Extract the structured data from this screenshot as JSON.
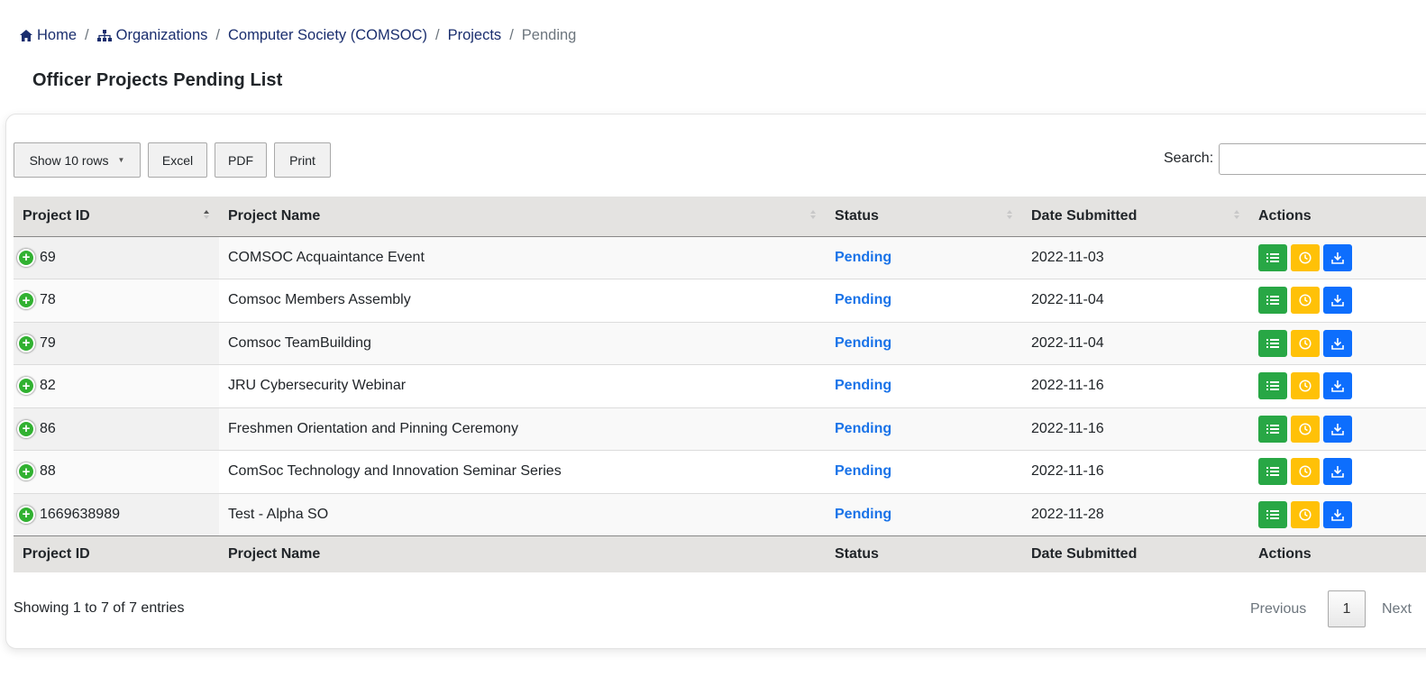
{
  "breadcrumb": {
    "home": "Home",
    "organizations": "Organizations",
    "organization": "Computer Society (COMSOC)",
    "projects": "Projects",
    "current": "Pending",
    "separator": "/"
  },
  "page_title": "Officer Projects Pending List",
  "toolbar": {
    "rows_label": "Show 10 rows",
    "excel_label": "Excel",
    "pdf_label": "PDF",
    "print_label": "Print",
    "search_label": "Search:",
    "search_value": ""
  },
  "table": {
    "columns": [
      "Project ID",
      "Project Name",
      "Status",
      "Date Submitted",
      "Actions"
    ],
    "rows": [
      {
        "id": "69",
        "name": "COMSOC Acquaintance Event",
        "status": "Pending",
        "date": "2022-11-03"
      },
      {
        "id": "78",
        "name": "Comsoc Members Assembly",
        "status": "Pending",
        "date": "2022-11-04"
      },
      {
        "id": "79",
        "name": "Comsoc TeamBuilding",
        "status": "Pending",
        "date": "2022-11-04"
      },
      {
        "id": "82",
        "name": "JRU Cybersecurity Webinar",
        "status": "Pending",
        "date": "2022-11-16"
      },
      {
        "id": "86",
        "name": "Freshmen Orientation and Pinning Ceremony",
        "status": "Pending",
        "date": "2022-11-16"
      },
      {
        "id": "88",
        "name": "ComSoc Technology and Innovation Seminar Series",
        "status": "Pending",
        "date": "2022-11-16"
      },
      {
        "id": "1669638989",
        "name": "Test - Alpha SO",
        "status": "Pending",
        "date": "2022-11-28"
      }
    ],
    "row_action_icons": [
      "list-icon",
      "clock-icon",
      "download-icon"
    ]
  },
  "footer": {
    "info": "Showing 1 to 7 of 7 entries",
    "previous": "Previous",
    "page": "1",
    "next": "Next"
  },
  "colors": {
    "link": "#1a2e6e",
    "status": "#1a73e8",
    "btn_list": "#28a745",
    "btn_clock": "#ffc107",
    "btn_download": "#0d6efd",
    "expand": "#31b131",
    "header_bg": "#e4e3e1"
  }
}
